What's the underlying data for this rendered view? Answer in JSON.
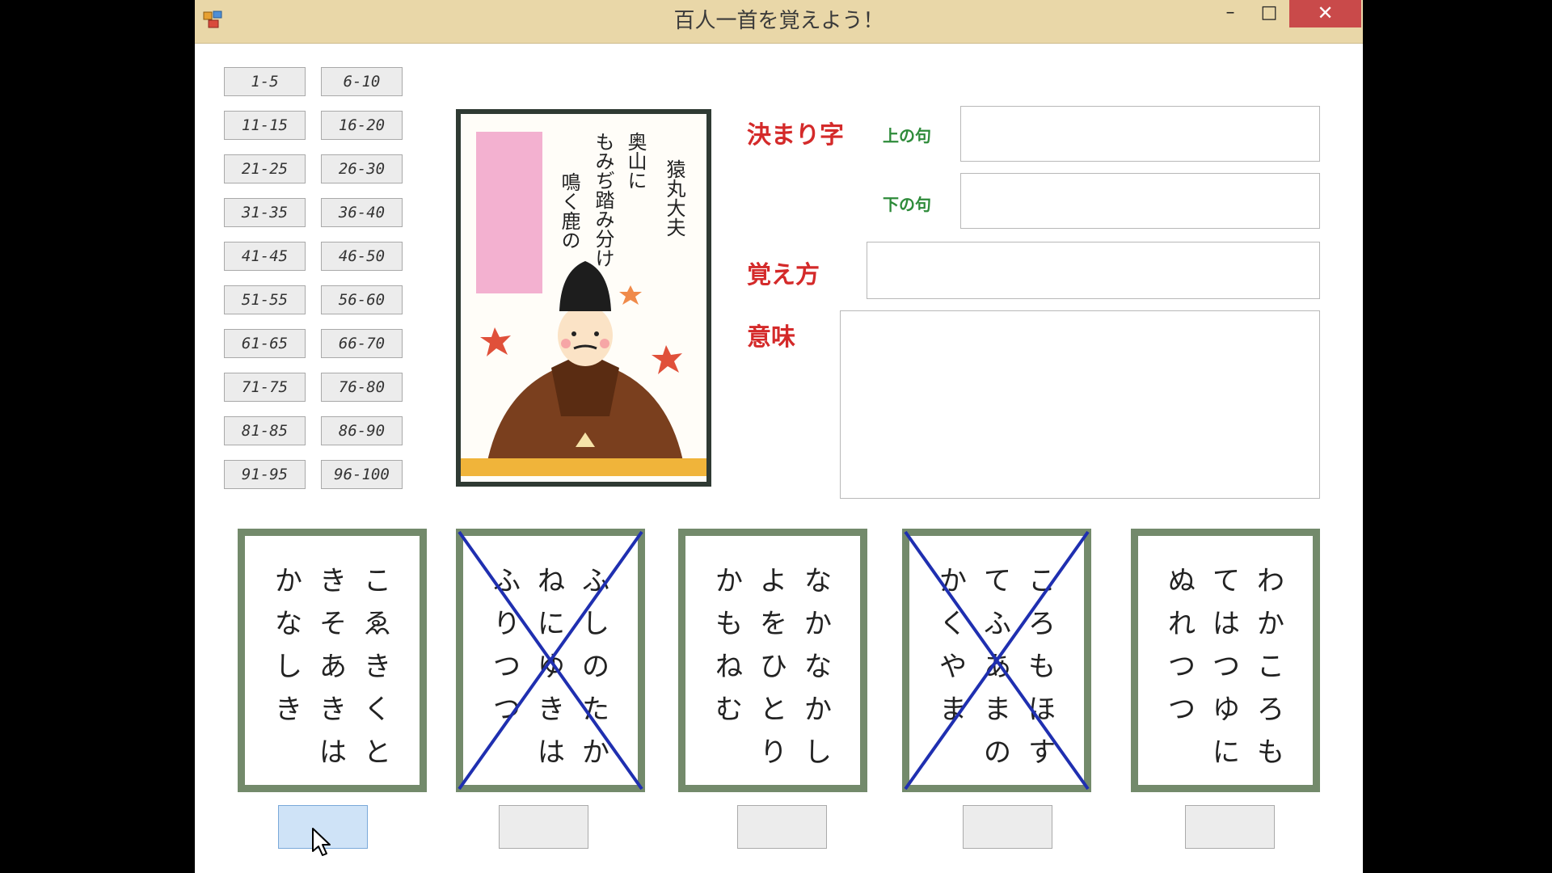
{
  "window": {
    "title": "百人一首を覚えよう！",
    "controls": {
      "minimize": "–",
      "maximize": "□",
      "close": "✕"
    }
  },
  "range_buttons": [
    [
      "1-5",
      "6-10"
    ],
    [
      "11-15",
      "16-20"
    ],
    [
      "21-25",
      "26-30"
    ],
    [
      "31-35",
      "36-40"
    ],
    [
      "41-45",
      "46-50"
    ],
    [
      "51-55",
      "56-60"
    ],
    [
      "61-65",
      "66-70"
    ],
    [
      "71-75",
      "76-80"
    ],
    [
      "81-85",
      "86-90"
    ],
    [
      "91-95",
      "96-100"
    ]
  ],
  "poem_card": {
    "poet": "猿丸大夫",
    "verse_lines": [
      "奥山に",
      "もみぢ踏み分け",
      "鳴く鹿の"
    ]
  },
  "form": {
    "kimariji_label": "決まり字",
    "upper_label": "上の句",
    "lower_label": "下の句",
    "oboekata_label": "覚え方",
    "imi_label": "意味",
    "upper_value": "",
    "lower_value": "",
    "oboekata_value": "",
    "imi_value": ""
  },
  "answer_cards": [
    {
      "columns": [
        "こゑきくと",
        "きそあきは",
        "かなしき"
      ],
      "crossed": false
    },
    {
      "columns": [
        "ふしのたか",
        "ねにゆきは",
        "ふりつつ"
      ],
      "crossed": true
    },
    {
      "columns": [
        "なかなかし",
        "よをひとり",
        "かもねむ"
      ],
      "crossed": false
    },
    {
      "columns": [
        "ころもほす",
        "てふあまの",
        "かくやま"
      ],
      "crossed": true
    },
    {
      "columns": [
        "わかころも",
        "てはつゆに",
        "ぬれつつ"
      ],
      "crossed": false
    }
  ],
  "answer_buttons": [
    {
      "label": "",
      "active": true
    },
    {
      "label": "",
      "active": false
    },
    {
      "label": "",
      "active": false
    },
    {
      "label": "",
      "active": false
    },
    {
      "label": "",
      "active": false
    }
  ],
  "colors": {
    "titlebar": "#e9d7a8",
    "close_button": "#c94a4a",
    "card_frame": "#738a6b",
    "cross_mark": "#1f2fb0",
    "label_red": "#d42a2a",
    "label_green": "#2e8b3a"
  }
}
